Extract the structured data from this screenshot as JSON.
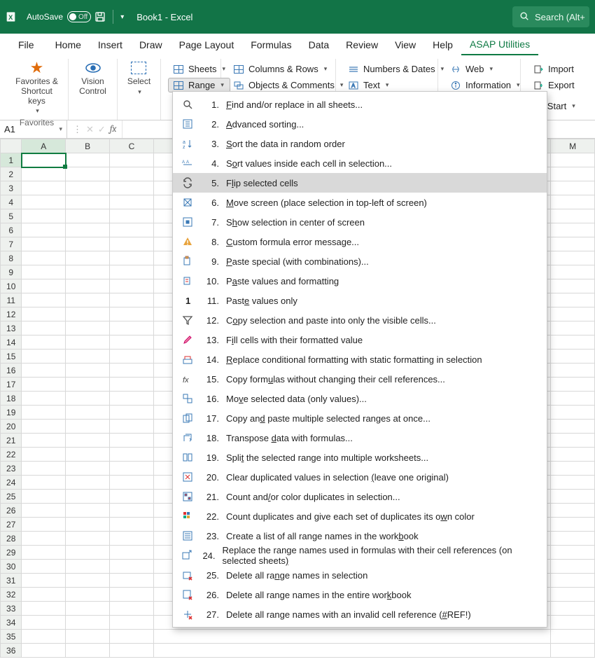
{
  "titlebar": {
    "autosave_label": "AutoSave",
    "autosave_state": "Off",
    "doc_title": "Book1  -  Excel",
    "search_placeholder": "Search (Alt+"
  },
  "tabs": [
    "File",
    "Home",
    "Insert",
    "Draw",
    "Page Layout",
    "Formulas",
    "Data",
    "Review",
    "View",
    "Help",
    "ASAP Utilities"
  ],
  "active_tab": "ASAP Utilities",
  "ribbon": {
    "group1": {
      "label": "Favorites &\nShortcut keys",
      "btn": "Favorites &\nShortcut keys",
      "footer": "Favorites"
    },
    "group2": {
      "btn": "Vision\nControl"
    },
    "group3": {
      "btn": "Select"
    },
    "col_a": {
      "sheets": "Sheets",
      "range": "Range"
    },
    "col_b": {
      "columnsrows": "Columns & Rows",
      "objects": "Objects & Comments"
    },
    "col_c": {
      "numbers": "Numbers & Dates",
      "text": "Text"
    },
    "col_d": {
      "web": "Web",
      "info": "Information"
    },
    "col_e": {
      "import": "Import",
      "export": "Export"
    },
    "start": "Start"
  },
  "namebox": "A1",
  "menu": {
    "items": [
      {
        "n": "1.",
        "label": "Find and/or replace in all sheets...",
        "u": "F",
        "icon": "search"
      },
      {
        "n": "2.",
        "label": "Advanced sorting...",
        "u": "A",
        "icon": "sort"
      },
      {
        "n": "3.",
        "label": "Sort the data in random order",
        "u": "S",
        "icon": "az"
      },
      {
        "n": "4.",
        "label": "Sort values inside each cell in selection...",
        "u": "o",
        "icon": "sortin"
      },
      {
        "n": "5.",
        "label": "Flip selected cells",
        "u": "l",
        "icon": "flip",
        "hover": true
      },
      {
        "n": "6.",
        "label": "Move screen (place selection in top-left of screen)",
        "u": "M",
        "icon": "move"
      },
      {
        "n": "7.",
        "label": "Show selection in center of screen",
        "u": "h",
        "icon": "center"
      },
      {
        "n": "8.",
        "label": "Custom formula error message...",
        "u": "C",
        "icon": "warn"
      },
      {
        "n": "9.",
        "label": "Paste special (with combinations)...",
        "u": "P",
        "icon": "paste"
      },
      {
        "n": "10.",
        "label": "Paste values and formatting",
        "u": "a",
        "icon": "pastefmt"
      },
      {
        "n": "11.",
        "label": "Paste values only",
        "u": "e",
        "icon": "one"
      },
      {
        "n": "12.",
        "label": "Copy selection and paste into only the visible cells...",
        "u": "o",
        "icon": "filter"
      },
      {
        "n": "13.",
        "label": "Fill cells with their formatted value",
        "u": "i",
        "icon": "brush"
      },
      {
        "n": "14.",
        "label": "Replace conditional formatting with static formatting in selection",
        "u": "R",
        "icon": "cond"
      },
      {
        "n": "15.",
        "label": "Copy formulas without changing their cell references...",
        "u": "u",
        "icon": "fx"
      },
      {
        "n": "16.",
        "label": "Move selected data (only values)...",
        "u": "v",
        "icon": "moved"
      },
      {
        "n": "17.",
        "label": "Copy and paste multiple selected ranges at once...",
        "u": "d",
        "icon": "copies"
      },
      {
        "n": "18.",
        "label": "Transpose data with formulas...",
        "u": "d",
        "icon": "transpose"
      },
      {
        "n": "19.",
        "label": "Split the selected range into multiple worksheets...",
        "u": "t",
        "icon": "split"
      },
      {
        "n": "20.",
        "label": "Clear duplicated values in selection (leave one original)",
        "u": "(",
        "icon": "cleardup"
      },
      {
        "n": "21.",
        "label": "Count and/or color duplicates in selection...",
        "u": "/",
        "icon": "countdup"
      },
      {
        "n": "22.",
        "label": "Count duplicates and give each set of duplicates its own color",
        "u": "w",
        "icon": "colorize"
      },
      {
        "n": "23.",
        "label": "Create a list of all range names in the workbook",
        "u": "b",
        "icon": "list"
      },
      {
        "n": "24.",
        "label": "Replace the range names used in formulas with their cell references (on selected sheets)",
        "u": ")",
        "icon": "replname"
      },
      {
        "n": "25.",
        "label": "Delete all range names in selection",
        "u": "n",
        "icon": "delsel"
      },
      {
        "n": "26.",
        "label": "Delete all range names in the entire workbook",
        "u": "k",
        "icon": "delwb"
      },
      {
        "n": "27.",
        "label": "Delete all range names with an invalid cell reference (#REF!)",
        "u": "#",
        "icon": "delref"
      }
    ]
  },
  "columns": [
    "A",
    "B",
    "C",
    "",
    "",
    "",
    "",
    "",
    "",
    "",
    "",
    "",
    "M"
  ],
  "rows": 36
}
